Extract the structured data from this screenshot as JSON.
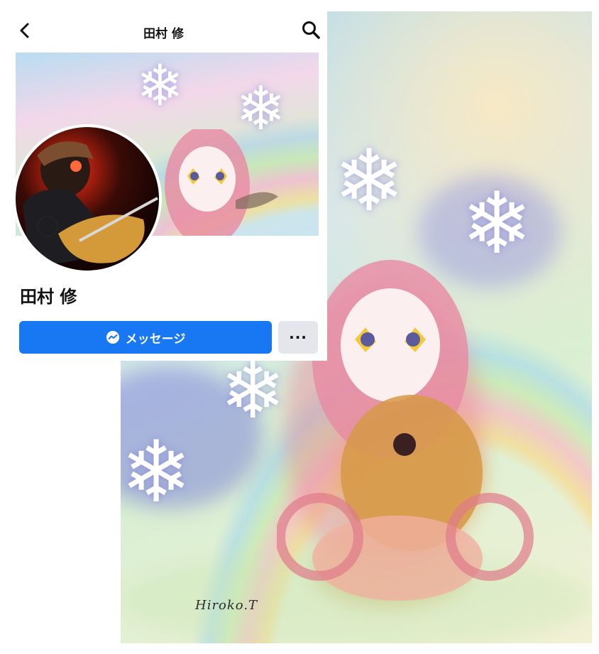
{
  "header": {
    "title": "田村 修",
    "back_icon": "chevron-left-icon",
    "search_icon": "search-icon"
  },
  "profile": {
    "name": "田村 修",
    "message_button_label": "メッセージ",
    "message_icon": "messenger-icon",
    "more_button_label": "···"
  },
  "artwork": {
    "signature": "Hiroko.T"
  },
  "colors": {
    "primary_button": "#1877f2",
    "secondary_button": "#e4e6eb",
    "text": "#111111"
  }
}
